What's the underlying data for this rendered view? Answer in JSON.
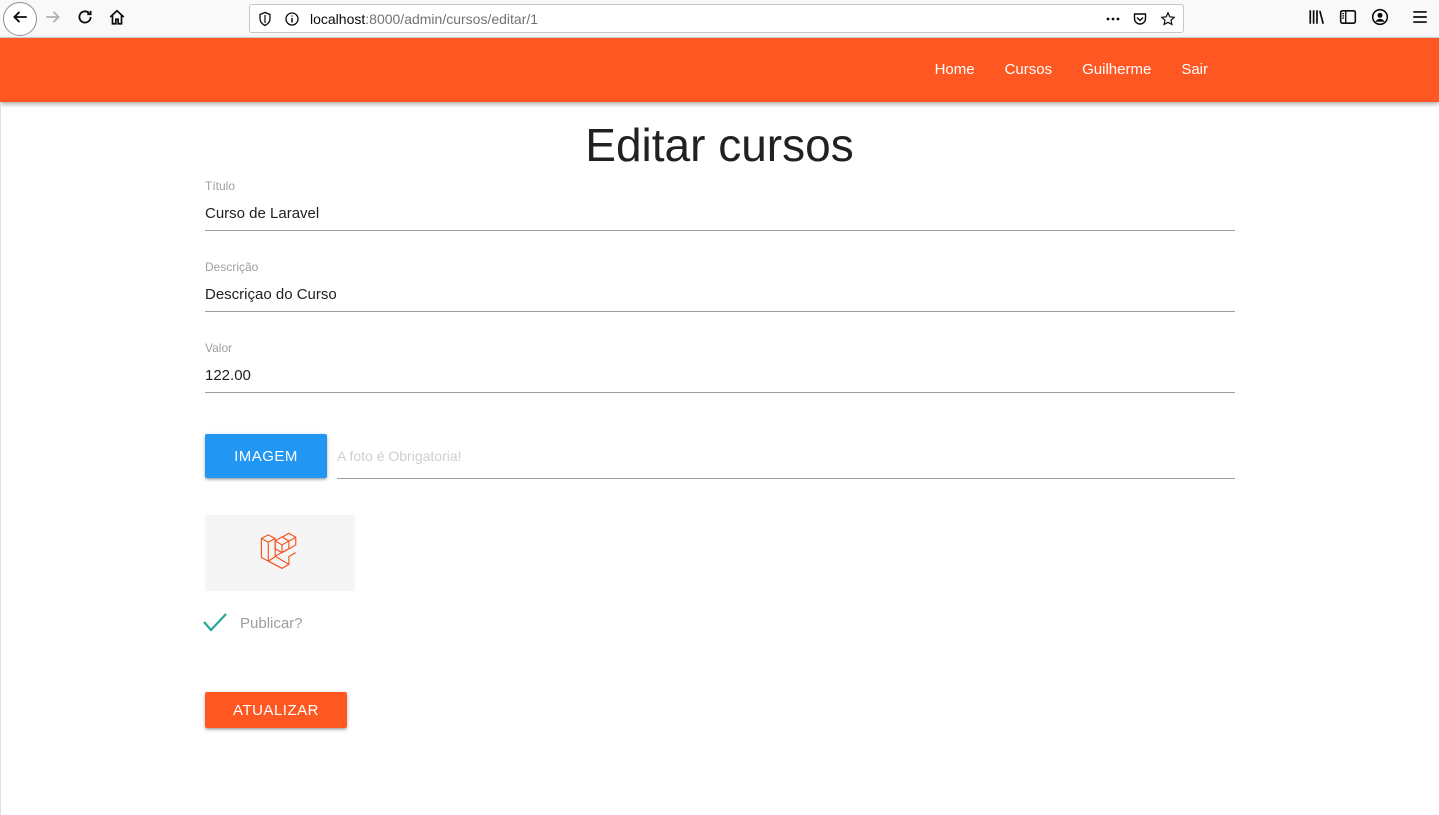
{
  "browser": {
    "url_host": "localhost",
    "url_path": ":8000/admin/cursos/editar/1",
    "icons": [
      "back-icon",
      "forward-icon",
      "reload-icon",
      "home-icon",
      "shield-icon",
      "info-icon",
      "more-icon",
      "pocket-icon",
      "bookmark-star-icon",
      "library-icon",
      "sidebar-icon",
      "account-icon",
      "menu-icon"
    ]
  },
  "navbar": {
    "color": "#ff5722",
    "links": [
      "Home",
      "Cursos",
      "Guilherme",
      "Sair"
    ]
  },
  "page": {
    "title": "Editar cursos"
  },
  "form": {
    "titulo": {
      "label": "Título",
      "value": "Curso de Laravel"
    },
    "descricao": {
      "label": "Descrição",
      "value": "Descriçao do Curso"
    },
    "valor": {
      "label": "Valor",
      "value": "122.00"
    },
    "imagem": {
      "button_label": "IMAGEM",
      "placeholder": "A foto é Obrigatoria!",
      "button_color": "#2196f3"
    },
    "thumbnail": {
      "icon": "laravel-logo-icon"
    },
    "publicar": {
      "label": "Publicar?",
      "checked": true,
      "check_color": "#26a69a"
    },
    "submit_label": "ATUALIZAR"
  }
}
